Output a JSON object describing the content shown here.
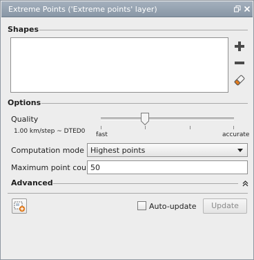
{
  "window": {
    "title": "Extreme Points ('Extreme points' layer)",
    "icons": [
      "restore-icon",
      "close-icon"
    ]
  },
  "shapes": {
    "heading": "Shapes",
    "tools": [
      "plus-icon",
      "minus-icon",
      "eraser-icon"
    ]
  },
  "options": {
    "heading": "Options",
    "quality": {
      "label": "Quality",
      "value_text": "1.00 km/step ~ DTED0",
      "min_label": "fast",
      "max_label": "accurate",
      "level": 0.36
    },
    "computation_mode": {
      "label": "Computation mode",
      "selected": "Highest points"
    },
    "max_count": {
      "label": "Maximum point count",
      "value": "50"
    }
  },
  "advanced": {
    "heading": "Advanced",
    "icon": "collapse-up-icon"
  },
  "footer": {
    "add_layer_icon": "add-layer-icon",
    "auto_update_label": "Auto-update",
    "auto_update_checked": false,
    "update_label": "Update",
    "update_enabled": false
  },
  "colors": {
    "titlebar": "#8896a5",
    "panel": "#ededed",
    "accent_orange": "#e07b1f"
  }
}
